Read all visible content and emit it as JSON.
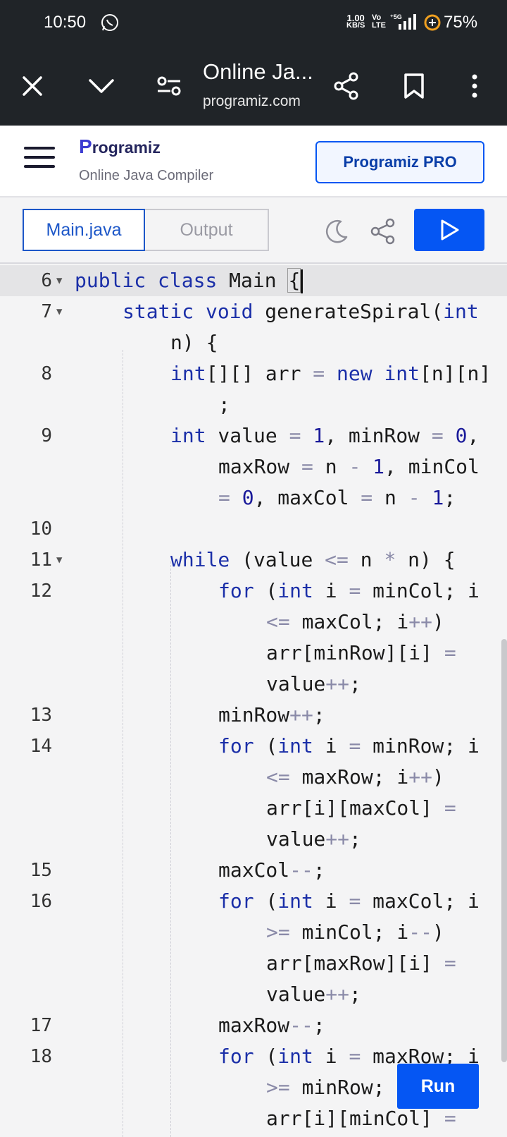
{
  "status_bar": {
    "time": "10:50",
    "net_speed_value": "1.00",
    "net_speed_unit": "KB/S",
    "volte_top": "Vo",
    "volte_bottom": "LTE",
    "network": "5G",
    "battery": "75%"
  },
  "browser_toolbar": {
    "title": "Online Ja...",
    "url": "programiz.com"
  },
  "site_header": {
    "logo_initial": "P",
    "logo_rest": "rogramiz",
    "subtitle": "Online Java Compiler",
    "pro_button": "Programiz PRO"
  },
  "tabs": {
    "main": "Main.java",
    "output": "Output"
  },
  "editor": {
    "lines": [
      {
        "n": "6",
        "fold": true,
        "text": "public class Main {"
      },
      {
        "n": "7",
        "fold": true,
        "text": "static void generateSpiral(int n) {"
      },
      {
        "n": "8",
        "fold": false,
        "text": "int[][] arr = new int[n][n];"
      },
      {
        "n": "9",
        "fold": false,
        "text": "int value = 1, minRow = 0, maxRow = n - 1, minCol = 0, maxCol = n - 1;"
      },
      {
        "n": "10",
        "fold": false,
        "text": ""
      },
      {
        "n": "11",
        "fold": true,
        "text": "while (value <= n * n) {"
      },
      {
        "n": "12",
        "fold": false,
        "text": "for (int i = minCol; i <= maxCol; i++) arr[minRow][i] = value++;"
      },
      {
        "n": "13",
        "fold": false,
        "text": "minRow++;"
      },
      {
        "n": "14",
        "fold": false,
        "text": "for (int i = minRow; i <= maxRow; i++) arr[i][maxCol] = value++;"
      },
      {
        "n": "15",
        "fold": false,
        "text": "maxCol--;"
      },
      {
        "n": "16",
        "fold": false,
        "text": "for (int i = maxCol; i >= minCol; i--) arr[maxRow][i] = value++;"
      },
      {
        "n": "17",
        "fold": false,
        "text": "maxRow--;"
      },
      {
        "n": "18",
        "fold": false,
        "text": "for (int i = maxRow; i >= minRow; i--) arr[i][minCol] ="
      }
    ]
  },
  "run_button_label": "Run",
  "colors": {
    "accent": "#0556f3",
    "keyword": "#1b2fa8",
    "toolbar_bg": "#202428"
  }
}
